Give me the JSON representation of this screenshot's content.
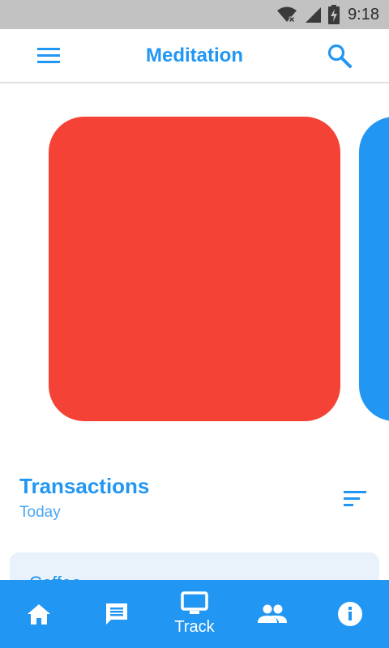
{
  "status_bar": {
    "time": "9:18",
    "icons": [
      "wifi-off-icon",
      "cell-signal-icon",
      "battery-charging-icon"
    ]
  },
  "app_bar": {
    "title": "Meditation",
    "left_icon": "menu-icon",
    "right_icon": "search-icon"
  },
  "carousel": {
    "cards": [
      {
        "color": "#f44336"
      },
      {
        "color": "#2196f3"
      }
    ]
  },
  "section": {
    "title": "Transactions",
    "subtitle": "Today",
    "action_icon": "sort-icon"
  },
  "list": {
    "first_item_text": "Coffee"
  },
  "bottom_nav": {
    "items": [
      {
        "icon": "home-icon",
        "label": ""
      },
      {
        "icon": "chat-icon",
        "label": ""
      },
      {
        "icon": "monitor-icon",
        "label": "Track"
      },
      {
        "icon": "people-icon",
        "label": ""
      },
      {
        "icon": "info-icon",
        "label": ""
      }
    ],
    "active_index": 2
  },
  "colors": {
    "primary": "#2196f3",
    "accent_red": "#f44336",
    "status_bar": "#c2c2c2",
    "card_bg": "#e9f1fb"
  }
}
